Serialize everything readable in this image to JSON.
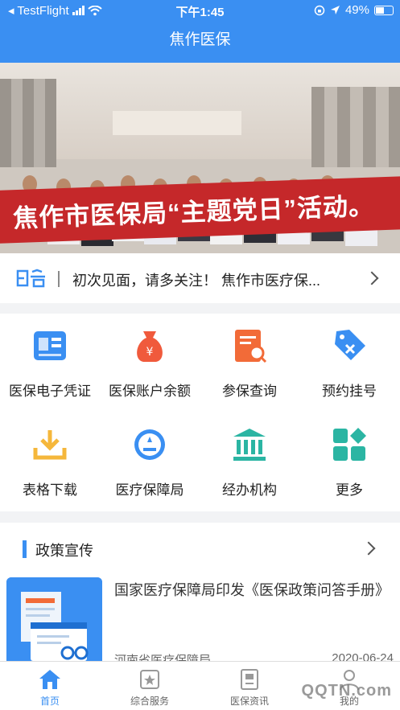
{
  "status_bar": {
    "carrier": "◂ TestFlight",
    "time": "下午1:45",
    "battery": "49%"
  },
  "app": {
    "title": "焦作医保"
  },
  "banner": {
    "text": "焦作市医保局“主题党日”活动。",
    "slide_count": 3,
    "active_slide": 2
  },
  "notice": {
    "label": "公告",
    "text": "初次见面，请多关注！ 焦作市医疗保..."
  },
  "services": [
    {
      "label": "医保电子凭证",
      "icon": "id-card-icon",
      "color": "#3a8ff2"
    },
    {
      "label": "医保账户余额",
      "icon": "money-bag-icon",
      "color": "#f05a3c"
    },
    {
      "label": "参保查询",
      "icon": "document-search-icon",
      "color": "#f26b38"
    },
    {
      "label": "预约挂号",
      "icon": "tag-icon",
      "color": "#3a8ff2"
    },
    {
      "label": "表格下载",
      "icon": "download-icon",
      "color": "#f5b73b"
    },
    {
      "label": "医疗保障局",
      "icon": "emblem-icon",
      "color": "#3a8ff2"
    },
    {
      "label": "经办机构",
      "icon": "building-icon",
      "color": "#2bb5a3"
    },
    {
      "label": "更多",
      "icon": "grid-icon",
      "color": "#2bb5a3"
    }
  ],
  "policy": {
    "section_title": "政策宣传",
    "article": {
      "title": "国家医疗保障局印发《医保政策问答手册》",
      "source": "河南省医疗保障局",
      "date": "2020-06-24"
    }
  },
  "tabs": [
    {
      "label": "首页",
      "icon": "home-icon",
      "active": true
    },
    {
      "label": "综合服务",
      "icon": "service-icon",
      "active": false
    },
    {
      "label": "医保资讯",
      "icon": "news-icon",
      "active": false
    },
    {
      "label": "我的",
      "icon": "user-icon",
      "active": false
    }
  ],
  "watermark": "QQTN.com",
  "colors": {
    "primary": "#3a8ff2",
    "banner_red": "#c5282a"
  }
}
